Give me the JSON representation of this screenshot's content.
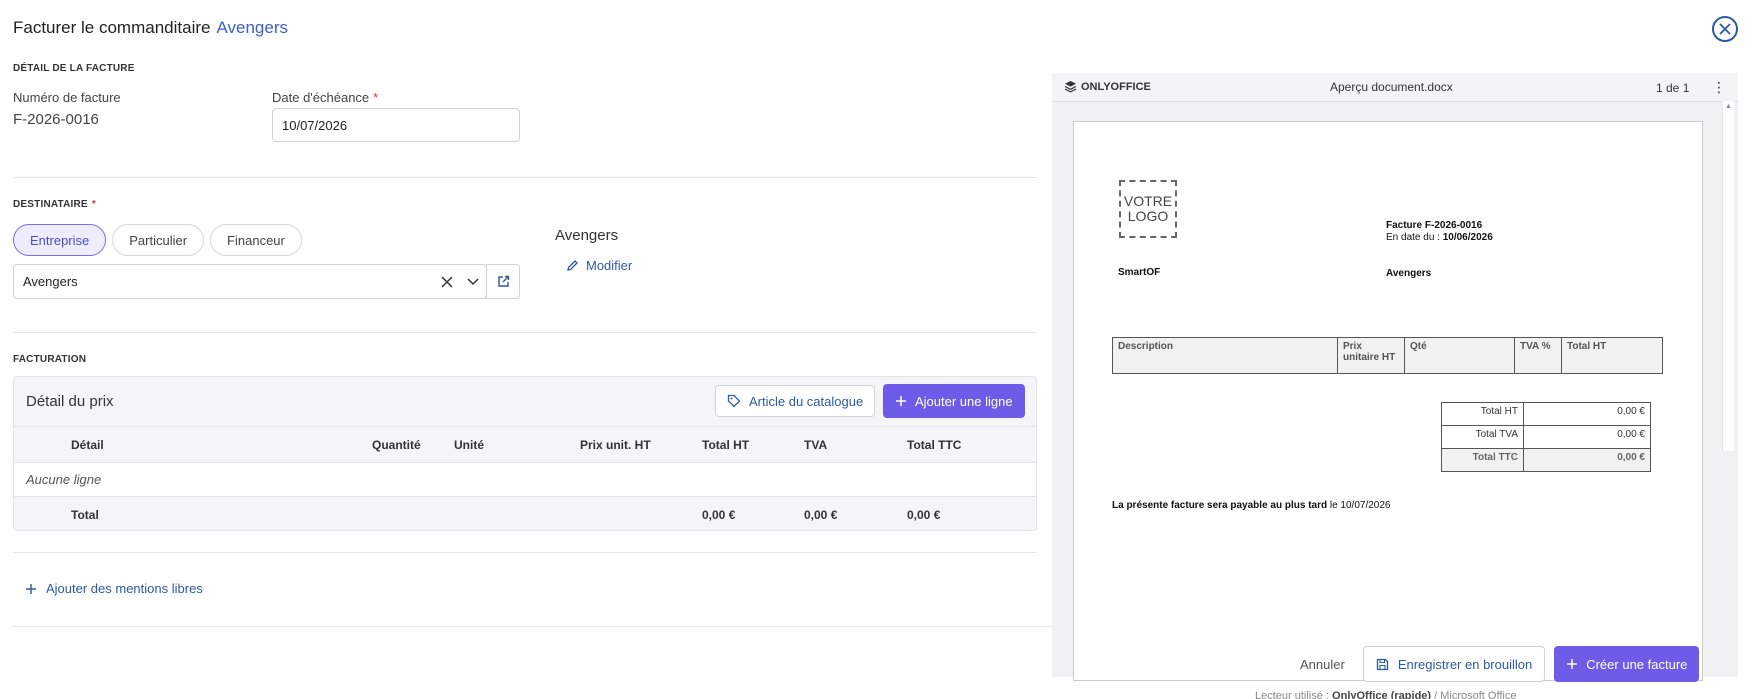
{
  "header": {
    "title": "Facturer le commanditaire",
    "subtitle": "Avengers"
  },
  "invoice_detail": {
    "section_title": "DÉTAIL DE LA FACTURE",
    "number_label": "Numéro de facture",
    "number_value": "F-2026-0016",
    "due_label": "Date d'échéance",
    "required_mark": "*",
    "due_value": "10/07/2026"
  },
  "recipient": {
    "section_title": "DESTINATAIRE",
    "required_mark": "*",
    "chips": [
      {
        "label": "Entreprise",
        "active": true
      },
      {
        "label": "Particulier",
        "active": false
      },
      {
        "label": "Financeur",
        "active": false
      }
    ],
    "select_value": "Avengers",
    "summary_name": "Avengers",
    "edit_label": "Modifier"
  },
  "billing": {
    "section_title": "FACTURATION",
    "card_title": "Détail du prix",
    "catalog_button": "Article du catalogue",
    "add_line_button": "Ajouter une ligne",
    "columns": [
      "Détail",
      "Quantité",
      "Unité",
      "Prix unit. HT",
      "Total HT",
      "TVA",
      "Total TTC"
    ],
    "empty_text": "Aucune ligne",
    "total_label": "Total",
    "total_ht": "0,00 €",
    "total_tva": "0,00 €",
    "total_ttc": "0,00 €",
    "free_mentions_link": "Ajouter des mentions libres"
  },
  "preview": {
    "brand": "ONLYOFFICE",
    "filename": "Aperçu document.docx",
    "page_indicator": "1 de 1",
    "logo_line1": "VOTRE",
    "logo_line2": "LOGO",
    "invoice_title": "Facture F-2026-0016",
    "date_prefix": "En date du : ",
    "date_value": "10/06/2026",
    "sender": "SmartOF",
    "recipient": "Avengers",
    "table_headers": [
      "Description",
      "Prix unitaire HT",
      "Qté",
      "TVA %",
      "Total HT"
    ],
    "totals": [
      {
        "label": "Total HT",
        "value": "0,00 €"
      },
      {
        "label": "Total TVA",
        "value": "0,00 €"
      },
      {
        "label": "Total TTC",
        "value": "0,00 €"
      }
    ],
    "payable_bold": "La présente facture sera payable au plus tard",
    "payable_date": " le 10/07/2026"
  },
  "footer": {
    "cancel": "Annuler",
    "save_draft": "Enregistrer en brouillon",
    "create": "Créer une facture",
    "reader_prefix": "Lecteur utilisé : ",
    "reader_active": "OnlyOffice (rapide)",
    "reader_sep": " / ",
    "reader_alt": "Microsoft Office"
  },
  "colors": {
    "accent": "#6c5ce7",
    "link": "#2d5aa0",
    "required": "#d13b3b"
  }
}
